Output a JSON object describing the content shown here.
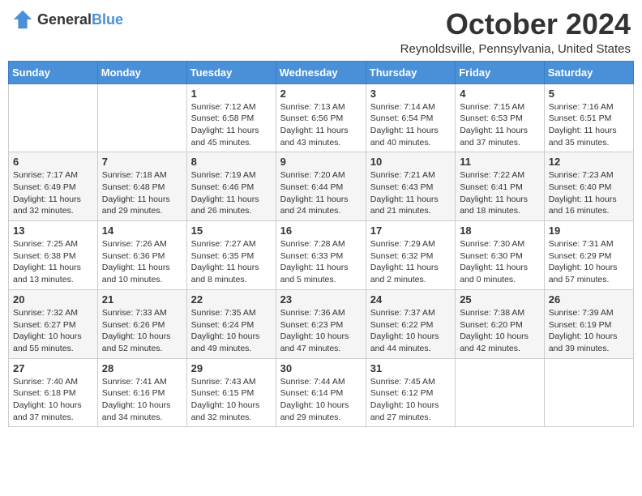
{
  "header": {
    "logo": {
      "general": "General",
      "blue": "Blue"
    },
    "month": "October 2024",
    "location": "Reynoldsville, Pennsylvania, United States"
  },
  "weekdays": [
    "Sunday",
    "Monday",
    "Tuesday",
    "Wednesday",
    "Thursday",
    "Friday",
    "Saturday"
  ],
  "weeks": [
    [
      {
        "day": "",
        "lines": []
      },
      {
        "day": "",
        "lines": []
      },
      {
        "day": "1",
        "lines": [
          "Sunrise: 7:12 AM",
          "Sunset: 6:58 PM",
          "Daylight: 11 hours",
          "and 45 minutes."
        ]
      },
      {
        "day": "2",
        "lines": [
          "Sunrise: 7:13 AM",
          "Sunset: 6:56 PM",
          "Daylight: 11 hours",
          "and 43 minutes."
        ]
      },
      {
        "day": "3",
        "lines": [
          "Sunrise: 7:14 AM",
          "Sunset: 6:54 PM",
          "Daylight: 11 hours",
          "and 40 minutes."
        ]
      },
      {
        "day": "4",
        "lines": [
          "Sunrise: 7:15 AM",
          "Sunset: 6:53 PM",
          "Daylight: 11 hours",
          "and 37 minutes."
        ]
      },
      {
        "day": "5",
        "lines": [
          "Sunrise: 7:16 AM",
          "Sunset: 6:51 PM",
          "Daylight: 11 hours",
          "and 35 minutes."
        ]
      }
    ],
    [
      {
        "day": "6",
        "lines": [
          "Sunrise: 7:17 AM",
          "Sunset: 6:49 PM",
          "Daylight: 11 hours",
          "and 32 minutes."
        ]
      },
      {
        "day": "7",
        "lines": [
          "Sunrise: 7:18 AM",
          "Sunset: 6:48 PM",
          "Daylight: 11 hours",
          "and 29 minutes."
        ]
      },
      {
        "day": "8",
        "lines": [
          "Sunrise: 7:19 AM",
          "Sunset: 6:46 PM",
          "Daylight: 11 hours",
          "and 26 minutes."
        ]
      },
      {
        "day": "9",
        "lines": [
          "Sunrise: 7:20 AM",
          "Sunset: 6:44 PM",
          "Daylight: 11 hours",
          "and 24 minutes."
        ]
      },
      {
        "day": "10",
        "lines": [
          "Sunrise: 7:21 AM",
          "Sunset: 6:43 PM",
          "Daylight: 11 hours",
          "and 21 minutes."
        ]
      },
      {
        "day": "11",
        "lines": [
          "Sunrise: 7:22 AM",
          "Sunset: 6:41 PM",
          "Daylight: 11 hours",
          "and 18 minutes."
        ]
      },
      {
        "day": "12",
        "lines": [
          "Sunrise: 7:23 AM",
          "Sunset: 6:40 PM",
          "Daylight: 11 hours",
          "and 16 minutes."
        ]
      }
    ],
    [
      {
        "day": "13",
        "lines": [
          "Sunrise: 7:25 AM",
          "Sunset: 6:38 PM",
          "Daylight: 11 hours",
          "and 13 minutes."
        ]
      },
      {
        "day": "14",
        "lines": [
          "Sunrise: 7:26 AM",
          "Sunset: 6:36 PM",
          "Daylight: 11 hours",
          "and 10 minutes."
        ]
      },
      {
        "day": "15",
        "lines": [
          "Sunrise: 7:27 AM",
          "Sunset: 6:35 PM",
          "Daylight: 11 hours",
          "and 8 minutes."
        ]
      },
      {
        "day": "16",
        "lines": [
          "Sunrise: 7:28 AM",
          "Sunset: 6:33 PM",
          "Daylight: 11 hours",
          "and 5 minutes."
        ]
      },
      {
        "day": "17",
        "lines": [
          "Sunrise: 7:29 AM",
          "Sunset: 6:32 PM",
          "Daylight: 11 hours",
          "and 2 minutes."
        ]
      },
      {
        "day": "18",
        "lines": [
          "Sunrise: 7:30 AM",
          "Sunset: 6:30 PM",
          "Daylight: 11 hours",
          "and 0 minutes."
        ]
      },
      {
        "day": "19",
        "lines": [
          "Sunrise: 7:31 AM",
          "Sunset: 6:29 PM",
          "Daylight: 10 hours",
          "and 57 minutes."
        ]
      }
    ],
    [
      {
        "day": "20",
        "lines": [
          "Sunrise: 7:32 AM",
          "Sunset: 6:27 PM",
          "Daylight: 10 hours",
          "and 55 minutes."
        ]
      },
      {
        "day": "21",
        "lines": [
          "Sunrise: 7:33 AM",
          "Sunset: 6:26 PM",
          "Daylight: 10 hours",
          "and 52 minutes."
        ]
      },
      {
        "day": "22",
        "lines": [
          "Sunrise: 7:35 AM",
          "Sunset: 6:24 PM",
          "Daylight: 10 hours",
          "and 49 minutes."
        ]
      },
      {
        "day": "23",
        "lines": [
          "Sunrise: 7:36 AM",
          "Sunset: 6:23 PM",
          "Daylight: 10 hours",
          "and 47 minutes."
        ]
      },
      {
        "day": "24",
        "lines": [
          "Sunrise: 7:37 AM",
          "Sunset: 6:22 PM",
          "Daylight: 10 hours",
          "and 44 minutes."
        ]
      },
      {
        "day": "25",
        "lines": [
          "Sunrise: 7:38 AM",
          "Sunset: 6:20 PM",
          "Daylight: 10 hours",
          "and 42 minutes."
        ]
      },
      {
        "day": "26",
        "lines": [
          "Sunrise: 7:39 AM",
          "Sunset: 6:19 PM",
          "Daylight: 10 hours",
          "and 39 minutes."
        ]
      }
    ],
    [
      {
        "day": "27",
        "lines": [
          "Sunrise: 7:40 AM",
          "Sunset: 6:18 PM",
          "Daylight: 10 hours",
          "and 37 minutes."
        ]
      },
      {
        "day": "28",
        "lines": [
          "Sunrise: 7:41 AM",
          "Sunset: 6:16 PM",
          "Daylight: 10 hours",
          "and 34 minutes."
        ]
      },
      {
        "day": "29",
        "lines": [
          "Sunrise: 7:43 AM",
          "Sunset: 6:15 PM",
          "Daylight: 10 hours",
          "and 32 minutes."
        ]
      },
      {
        "day": "30",
        "lines": [
          "Sunrise: 7:44 AM",
          "Sunset: 6:14 PM",
          "Daylight: 10 hours",
          "and 29 minutes."
        ]
      },
      {
        "day": "31",
        "lines": [
          "Sunrise: 7:45 AM",
          "Sunset: 6:12 PM",
          "Daylight: 10 hours",
          "and 27 minutes."
        ]
      },
      {
        "day": "",
        "lines": []
      },
      {
        "day": "",
        "lines": []
      }
    ]
  ]
}
